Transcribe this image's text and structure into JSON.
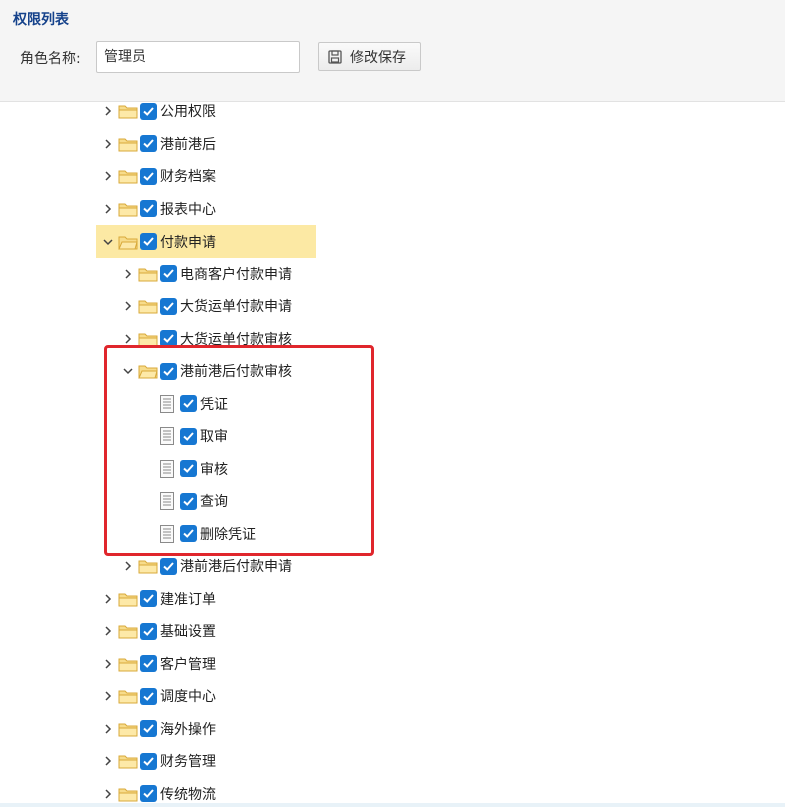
{
  "panel": {
    "title": "权限列表"
  },
  "form": {
    "role_label": "角色名称:",
    "role_value": "管理员",
    "save_label": "修改保存"
  },
  "colors": {
    "checkbox": "#1677d2",
    "selected_row": "#fce9a4",
    "highlight_box": "#e0262c",
    "title": "#15428b"
  },
  "tree": [
    {
      "label": "公用权限",
      "level": 0,
      "kind": "folder",
      "expanded": false
    },
    {
      "label": "港前港后",
      "level": 0,
      "kind": "folder",
      "expanded": false
    },
    {
      "label": "财务档案",
      "level": 0,
      "kind": "folder",
      "expanded": false
    },
    {
      "label": "报表中心",
      "level": 0,
      "kind": "folder",
      "expanded": false
    },
    {
      "label": "付款申请",
      "level": 0,
      "kind": "folder",
      "expanded": true,
      "selected": true
    },
    {
      "label": "电商客户付款申请",
      "level": 1,
      "kind": "folder",
      "expanded": false
    },
    {
      "label": "大货运单付款申请",
      "level": 1,
      "kind": "folder",
      "expanded": false
    },
    {
      "label": "大货运单付款审核",
      "level": 1,
      "kind": "folder",
      "expanded": false
    },
    {
      "label": "港前港后付款审核",
      "level": 1,
      "kind": "folder",
      "expanded": true
    },
    {
      "label": "凭证",
      "level": 2,
      "kind": "leaf"
    },
    {
      "label": "取审",
      "level": 2,
      "kind": "leaf"
    },
    {
      "label": "审核",
      "level": 2,
      "kind": "leaf"
    },
    {
      "label": "查询",
      "level": 2,
      "kind": "leaf"
    },
    {
      "label": "删除凭证",
      "level": 2,
      "kind": "leaf"
    },
    {
      "label": "港前港后付款申请",
      "level": 1,
      "kind": "folder",
      "expanded": false
    },
    {
      "label": "建准订单",
      "level": 0,
      "kind": "folder",
      "expanded": false
    },
    {
      "label": "基础设置",
      "level": 0,
      "kind": "folder",
      "expanded": false
    },
    {
      "label": "客户管理",
      "level": 0,
      "kind": "folder",
      "expanded": false
    },
    {
      "label": "调度中心",
      "level": 0,
      "kind": "folder",
      "expanded": false
    },
    {
      "label": "海外操作",
      "level": 0,
      "kind": "folder",
      "expanded": false
    },
    {
      "label": "财务管理",
      "level": 0,
      "kind": "folder",
      "expanded": false
    },
    {
      "label": "传统物流",
      "level": 0,
      "kind": "folder",
      "expanded": false
    }
  ]
}
